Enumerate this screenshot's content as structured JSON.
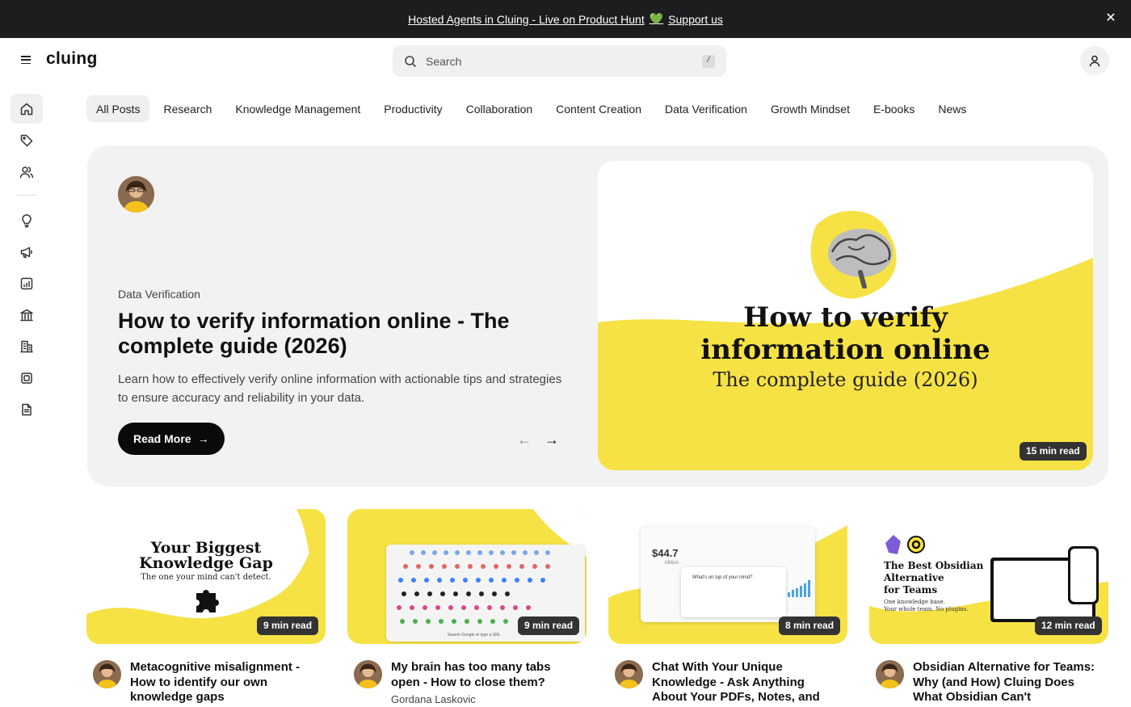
{
  "announcement": {
    "text": "Hosted Agents in Cluing - Live on Product Hunt",
    "link_text": "Support us"
  },
  "header": {
    "logo": "cluing",
    "search_placeholder": "Search",
    "search_shortcut": "/"
  },
  "tabs": [
    {
      "label": "All Posts",
      "active": true
    },
    {
      "label": "Research"
    },
    {
      "label": "Knowledge Management"
    },
    {
      "label": "Productivity"
    },
    {
      "label": "Collaboration"
    },
    {
      "label": "Content Creation"
    },
    {
      "label": "Data Verification"
    },
    {
      "label": "Growth Mindset"
    },
    {
      "label": "E-books"
    },
    {
      "label": "News"
    }
  ],
  "hero": {
    "category": "Data Verification",
    "title": "How to verify information online - The complete guide (2026)",
    "description": "Learn how to effectively verify online information with actionable tips and strategies to ensure accuracy and reliability in your data.",
    "button": "Read More",
    "image_title_line1": "How to verify",
    "image_title_line2": "information online",
    "image_subtitle": "The complete guide (2026)",
    "read_time": "15 min read"
  },
  "cards": [
    {
      "read_time": "9 min read",
      "title": "Metacognitive misalignment - How to identify our own knowledge gaps",
      "author": "",
      "image_title_line1": "Your Biggest",
      "image_title_line2": "Knowledge Gap",
      "image_subtitle": "The one your mind can't detect."
    },
    {
      "read_time": "9 min read",
      "title": "My brain has too many tabs open - How to close them?",
      "author": "Gordana Laskovic",
      "image_searchbar": "Search Google or type a URL"
    },
    {
      "read_time": "8 min read",
      "title": "Chat With Your Unique Knowledge - Ask Anything About Your PDFs, Notes, and",
      "author": "",
      "image_amount": "$44.7",
      "image_amount_unit": "Million",
      "image_prompt": "What's on top of your mind?"
    },
    {
      "read_time": "12 min read",
      "title": "Obsidian Alternative for Teams: Why (and How) Cluing Does What Obsidian Can't",
      "author": "",
      "image_title_line1": "The Best Obsidian",
      "image_title_line2": "Alternative",
      "image_title_line3": "for Teams",
      "image_subtitle_line1": "One knowledge base.",
      "image_subtitle_line2": "Your whole team. No plugins."
    }
  ],
  "colors": {
    "accent_yellow": "#f7e245",
    "dark": "#1d1d1f",
    "surface": "#f2f2f2",
    "heart": "#34c77b"
  }
}
